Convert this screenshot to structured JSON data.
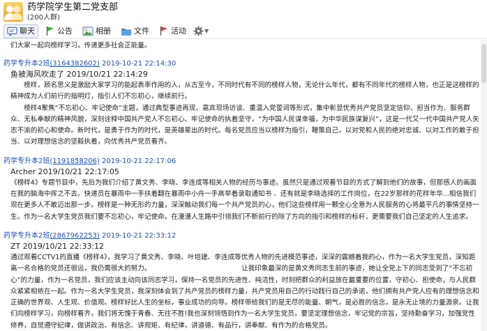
{
  "header": {
    "group_name": "药学院学生第二党支部",
    "member_count": "(200人群)"
  },
  "toolbar": {
    "items": [
      {
        "label": "聊天",
        "icon": "chat-icon"
      },
      {
        "label": "公告",
        "icon": "flag-icon"
      },
      {
        "label": "相册",
        "icon": "photo-icon"
      },
      {
        "label": "文件",
        "icon": "folder-icon"
      },
      {
        "label": "活动",
        "icon": "event-icon"
      }
    ],
    "settings_icon": "gear-icon"
  },
  "chat": {
    "top_line": "们大家一起向榜样学习，传递更多社会正能量。",
    "messages": [
      {
        "sender": "药学专升本2班",
        "qq": "(3164382602)",
        "time": "2019-10-21 22:14:30",
        "head": "鱼被海风吹走了 2019/10/21 22:14:29",
        "body": "　　榜样，顾名思义是激励大家学习的能起表率作用的人，从古至今，不同时代有不同的榜样人物，无论什么年代，都有不同年代的榜样人物，也正是这榜样的精神成为人们前行的指明灯，指引人们不忘初心，继续前行。\n　　榜样4聚焦“不忘初心、牢记使命”主题，通过典型事迹再现、嘉宾现场访谈、重温入党誓词等形式，集中彰显优秀共产党员坚定信仰、担当作为、服务群众、无私奉献的精神风貌，深刻诠释中国共产党人不忘初心、牢记使命的执着坚守，“为中国人民谋幸福，为中华民族谋复兴”，这是一代又一代中国共产党人矢志不渝的初心和使命。新时代，是勇于作为的时代，是英雄辈出的时代。每名党员应当以榜样为指引，鞭策自己，以对党和人民的绝对忠诚、以对工作的敢于担当、以对理想信念的坚毅执着，向优秀共产党员看齐。"
      },
      {
        "sender": "药学专升本2班",
        "qq": "(1191858206)",
        "time": "2019-10-21 22:17:06",
        "head": "Archer 2019/10/21 22:17:05",
        "body": "《榜样4》专题节目中，先后为我们介绍了黄文秀、李晓、李连成等相关人物的经历与事迹。虽然只是通过观看节目的方式了解到他们的故事，但那感人的画面在我的脑海中挥之不去。快递员在暴雨中一手扶着翻在暴雨中小舟一手高举着录取通知书 、还有就是李晓选择的工作岗位，在22岁那样的花样年华...相信我们现在更多人不敢迈出那一步。榜样是一种无形的力量，深深触动我们每一个共产党员的心，他们这些榜样用一颗全心全意为人民服务的心将最平凡的事情坚持一生。作为一名大学生党员我们要不忘初心，牢记使命。在漫漫人生路中引领我们不断前行的除了方向的指引和榜样的标杆，更需要我们自己坚定的人生追求。"
      },
      {
        "sender": "药学专升本2班",
        "qq": "(2867962253)",
        "time": "2019-10-21 22:33:12",
        "head": "ZT 2019/10/21 22:33:12",
        "body": "通过观看CCTV1的直播《榜样4》，我学习了黄文秀、李晓、叶培建、李连成等优秀人物的先进模范事迹，深深的震撼着我的心，作为一名大学生党员，深知距离一名合格的党员还很远，我仍需很大的努力。　　　　　　　　　　　　　　让我印象最深的是黄文秀同志生前的事迹，她让全党上下的同志受到了“不忘初心”的力量，作为一名党员，我们应该主动向该同志学习，保持一名党员的先进性、纯洁性，时刻把群众的利益放在最重要的位置，守初心、担使命，与人民群众紧紧相依在一起。作为一名大学生党员，我深刻体会到了共产党员的榜样力量，共产党员用自己的行动践行自己的承诺，他们拥有共产党人应有的理想信念和正确的世界观、人生观、价值观。榜样好比人生的坐标，事业成功的向导。榜样带给我们的是无尽的能量、朝气，是必胜的信念，是永无止境的力量源泉。让我们向榜样学习，向榜样看齐，我们将无愧于青春、无往不胜!我也深刻领悟到作为一名大学生党员，要坚定理想信念，牢记党的宗旨，坚持勤奋学习，加强党性修养，自觉遵守纪律，做讲政治、有信念、讲规矩、有纪律，讲道德、有品行，讲奉献、有作为的合格党员。"
      }
    ]
  }
}
